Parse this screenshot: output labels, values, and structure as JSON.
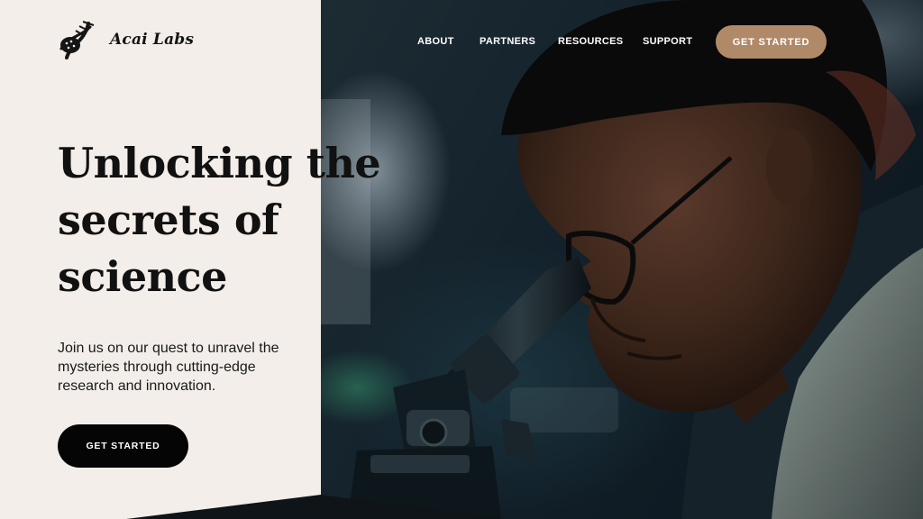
{
  "brand": {
    "name": "Acai Labs",
    "logo_icon": "dna-helix-icon"
  },
  "nav": {
    "items": [
      {
        "label": "ABOUT"
      },
      {
        "label": "PARTNERS"
      },
      {
        "label": "RESOURCES"
      },
      {
        "label": "SUPPORT"
      }
    ],
    "cta_label": "GET STARTED"
  },
  "hero": {
    "headline_lines": [
      "Unlocking the",
      "secrets of",
      "science"
    ],
    "subtext": "Join us on our quest to unravel the mysteries through cutting-edge research and innovation.",
    "cta_label": "GET STARTED",
    "image_subject": "scientist-at-microscope"
  },
  "colors": {
    "background": "#f3eee9",
    "nav_cta": "#b08a68",
    "hero_cta": "#050505",
    "text": "#111111"
  }
}
